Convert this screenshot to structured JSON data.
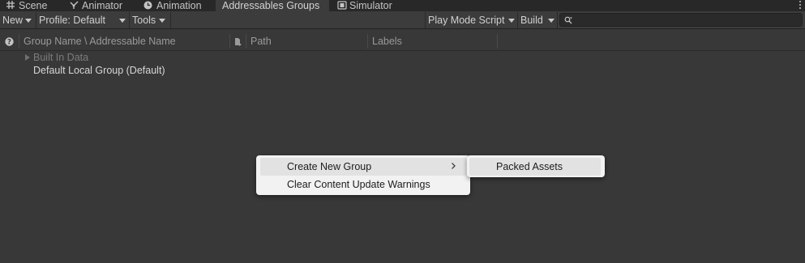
{
  "tabs": [
    {
      "label": "Scene",
      "icon": "grid-icon"
    },
    {
      "label": "Animator",
      "icon": "animator-icon"
    },
    {
      "label": "Animation",
      "icon": "clock-icon"
    },
    {
      "label": "Addressables Groups",
      "icon": ""
    },
    {
      "label": "Simulator",
      "icon": "simulator-icon"
    }
  ],
  "toolbar": {
    "new_label": "New",
    "profile_label": "Profile: Default",
    "tools_label": "Tools",
    "play_mode_label": "Play Mode Script",
    "build_label": "Build",
    "search_value": "",
    "search_placeholder": ""
  },
  "columns": {
    "name": "Group Name \\ Addressable Name",
    "path": "Path",
    "labels": "Labels"
  },
  "tree": [
    {
      "label": "Built In Data",
      "dimmed": true,
      "expandable": true
    },
    {
      "label": "Default Local Group (Default)",
      "dimmed": false,
      "expandable": false
    }
  ],
  "context_menu": {
    "items": [
      "Create New Group",
      "Clear Content Update Warnings"
    ],
    "submenu": [
      "Packed Assets"
    ]
  },
  "colors": {
    "background": "#383838",
    "toolbar": "#3c3c3c",
    "tabbar": "#282828",
    "menu": "#f2f2f2",
    "menu_hover": "#e2e2e2"
  }
}
